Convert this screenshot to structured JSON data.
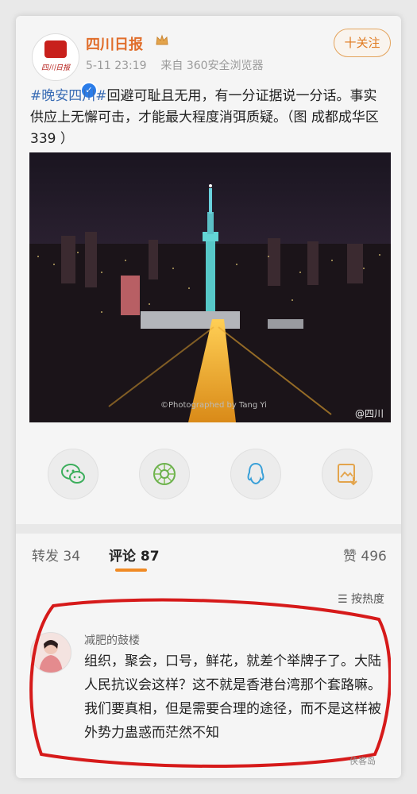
{
  "header": {
    "account_name": "四川日报",
    "logo_text": "四川日报",
    "timestamp": "5-11 23:19",
    "source": "来自 360安全浏览器",
    "follow_label": "十关注"
  },
  "post": {
    "hashtag": "#晚安四川#",
    "text": "回避可耻且无用，有一分证据说一分话。事实供应上无懈可击，才能最大程度消弭质疑。（图 成都成华区339 ）",
    "photo_credit": "©Photographed by Tang Yi",
    "photo_watermark": "@四川"
  },
  "share": {
    "icons": [
      "wechat-icon",
      "moments-icon",
      "qq-icon",
      "save-image-icon"
    ]
  },
  "tabs": {
    "repost": "转发 34",
    "comments": "评论 87",
    "likes": "赞 496"
  },
  "sort": {
    "label": "☰ 按热度"
  },
  "comment": {
    "author": "减肥的鼓楼",
    "body": "组织，聚会，口号，鲜花，就差个举牌子了。大陆人民抗议会这样？这不就是香港台湾那个套路嘛。我们要真相，但是需要合理的途径，而不是这样被外势力蛊惑而茫然不知"
  },
  "watermark": {
    "corner": "侠客岛"
  },
  "colors": {
    "accent": "#f08a24",
    "name": "#e06d2a",
    "tag": "#3b6db5",
    "annotation": "#d61a1a"
  }
}
